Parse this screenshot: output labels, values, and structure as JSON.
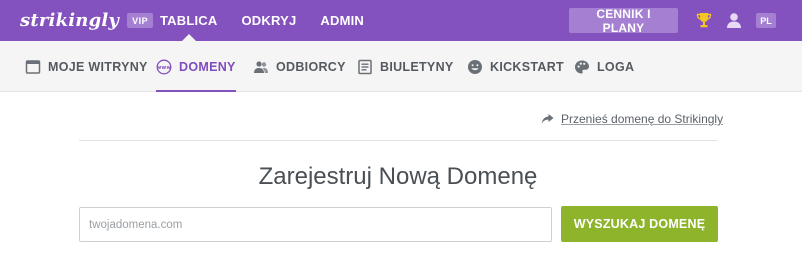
{
  "header": {
    "logo_text": "strikingly",
    "vip_badge": "VIP",
    "nav": [
      {
        "label": "TABLICA",
        "active": true
      },
      {
        "label": "ODKRYJ",
        "active": false
      },
      {
        "label": "ADMIN",
        "active": false
      }
    ],
    "plans_button": "CENNIK I PLANY",
    "language": "PL",
    "icons": {
      "trophy": "trophy-icon",
      "user": "user-icon"
    }
  },
  "subnav": {
    "items": [
      {
        "label": "MOJE WITRYNY",
        "icon": "browser-window-icon",
        "active": false
      },
      {
        "label": "DOMENY",
        "icon": "www-globe-icon",
        "active": true
      },
      {
        "label": "ODBIORCY",
        "icon": "people-icon",
        "active": false
      },
      {
        "label": "BIULETYNY",
        "icon": "newsletter-icon",
        "active": false
      },
      {
        "label": "KICKSTART",
        "icon": "smiley-icon",
        "active": false
      },
      {
        "label": "LOGA",
        "icon": "palette-icon",
        "active": false
      }
    ]
  },
  "main": {
    "transfer_link": "Przenieś domenę do Strikingly",
    "heading": "Zarejestruj Nową Domenę",
    "domain_input": {
      "value": "",
      "placeholder": "twojadomena.com"
    },
    "search_button": "WYSZUKAJ DOMENĘ"
  },
  "colors": {
    "brand_purple": "#8452bf",
    "badge_purple": "#a47fd2",
    "active_purple": "#7e4cbf",
    "search_green": "#8db42a"
  }
}
